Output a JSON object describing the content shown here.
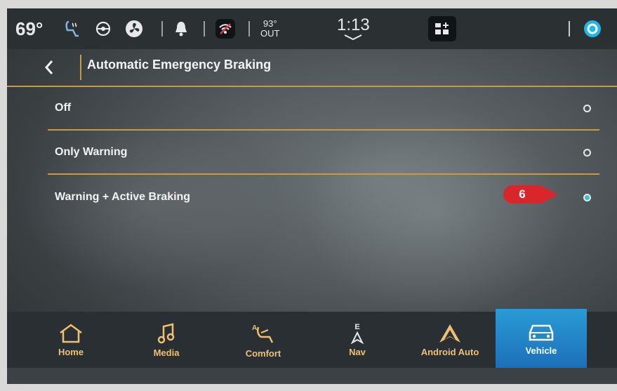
{
  "statusbar": {
    "temperature": "69°",
    "outside_temp": "93°",
    "outside_label": "OUT",
    "clock": "1:13",
    "icons": [
      "heated-seat-icon",
      "heated-steering-icon",
      "fan-icon",
      "bell-icon",
      "wifi-off-icon",
      "apps-icon",
      "voice-assistant-icon"
    ]
  },
  "header": {
    "title": "Automatic Emergency Braking",
    "back_icon": "chevron-left-icon"
  },
  "options": [
    {
      "label": "Off",
      "selected": false
    },
    {
      "label": "Only Warning",
      "selected": false
    },
    {
      "label": "Warning + Active Braking",
      "selected": true
    }
  ],
  "callout": {
    "number": "6",
    "color": "#d9262b"
  },
  "nav": [
    {
      "label": "Home",
      "icon": "home-icon",
      "active": false
    },
    {
      "label": "Media",
      "icon": "music-note-icon",
      "active": false
    },
    {
      "label": "Comfort",
      "icon": "seat-icon",
      "active": false
    },
    {
      "label": "Nav",
      "icon": "compass-icon",
      "compass": "E",
      "active": false
    },
    {
      "label": "Android Auto",
      "icon": "android-auto-icon",
      "active": false
    },
    {
      "label": "Vehicle",
      "icon": "car-icon",
      "active": true
    }
  ],
  "colors": {
    "accent_line": "#c69a4a",
    "selected_radio": "#35c4d4",
    "active_nav": "#2a9bd6",
    "nav_text": "#f0c070"
  }
}
